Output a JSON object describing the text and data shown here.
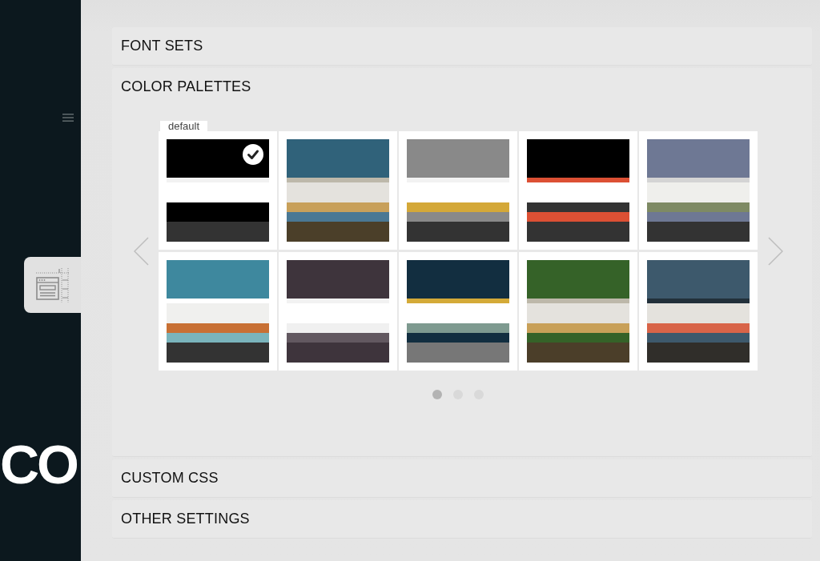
{
  "background": {
    "hero_text": "CO"
  },
  "sections": [
    {
      "title": "FONT SETS",
      "expanded": false
    },
    {
      "title": "COLOR PALETTES",
      "expanded": true,
      "palettes": [
        {
          "label": "default",
          "selected": true,
          "stripes": [
            {
              "color": "#000000"
            },
            {
              "color": "#f2f2f2"
            },
            {
              "color": "#ffffff"
            },
            {
              "color": "#000000"
            },
            {
              "color": "#000000"
            },
            {
              "color": "#333333"
            }
          ]
        },
        {
          "selected": false,
          "stripes": [
            {
              "color": "#30627a"
            },
            {
              "color": "#bdb8aa"
            },
            {
              "color": "#e4e2dd"
            },
            {
              "color": "#c8a05a"
            },
            {
              "color": "#4a7894"
            },
            {
              "color": "#4b3f29"
            }
          ]
        },
        {
          "selected": false,
          "stripes": [
            {
              "color": "#898989"
            },
            {
              "color": "#f2f2f2"
            },
            {
              "color": "#ffffff"
            },
            {
              "color": "#d4a838"
            },
            {
              "color": "#898989"
            },
            {
              "color": "#333333"
            }
          ]
        },
        {
          "selected": false,
          "stripes": [
            {
              "color": "#000000"
            },
            {
              "color": "#dc5034"
            },
            {
              "color": "#ffffff"
            },
            {
              "color": "#333333"
            },
            {
              "color": "#dc5034"
            },
            {
              "color": "#333333"
            }
          ]
        },
        {
          "selected": false,
          "stripes": [
            {
              "color": "#6e7894"
            },
            {
              "color": "#d4d4d4"
            },
            {
              "color": "#efefec"
            },
            {
              "color": "#7e8a64"
            },
            {
              "color": "#6e7894"
            },
            {
              "color": "#333333"
            }
          ]
        },
        {
          "selected": false,
          "stripes": [
            {
              "color": "#3e889e"
            },
            {
              "color": "#ffffff"
            },
            {
              "color": "#f0f0ee"
            },
            {
              "color": "#c87034"
            },
            {
              "color": "#7ab4bc"
            },
            {
              "color": "#333333"
            }
          ]
        },
        {
          "selected": false,
          "stripes": [
            {
              "color": "#3e343c"
            },
            {
              "color": "#f2f2f2"
            },
            {
              "color": "#ffffff"
            },
            {
              "color": "#f0f0f0"
            },
            {
              "color": "#625860"
            },
            {
              "color": "#3e343c"
            }
          ]
        },
        {
          "selected": false,
          "stripes": [
            {
              "color": "#122e40"
            },
            {
              "color": "#d4aa38"
            },
            {
              "color": "#ffffff"
            },
            {
              "color": "#7e9a90"
            },
            {
              "color": "#122e40"
            },
            {
              "color": "#777777"
            }
          ]
        },
        {
          "selected": false,
          "stripes": [
            {
              "color": "#356228"
            },
            {
              "color": "#bdb8aa"
            },
            {
              "color": "#e4e2dd"
            },
            {
              "color": "#c8a058"
            },
            {
              "color": "#356228"
            },
            {
              "color": "#4b3e29"
            }
          ]
        },
        {
          "selected": false,
          "stripes": [
            {
              "color": "#3d596c"
            },
            {
              "color": "#22303a"
            },
            {
              "color": "#e4e2dd"
            },
            {
              "color": "#d86448"
            },
            {
              "color": "#3d596c"
            },
            {
              "color": "#302e2a"
            }
          ]
        }
      ],
      "pages": [
        {
          "selected": true
        },
        {
          "selected": false
        },
        {
          "selected": false
        }
      ]
    },
    {
      "title": "CUSTOM CSS",
      "expanded": false
    },
    {
      "title": "OTHER SETTINGS",
      "expanded": false
    }
  ]
}
